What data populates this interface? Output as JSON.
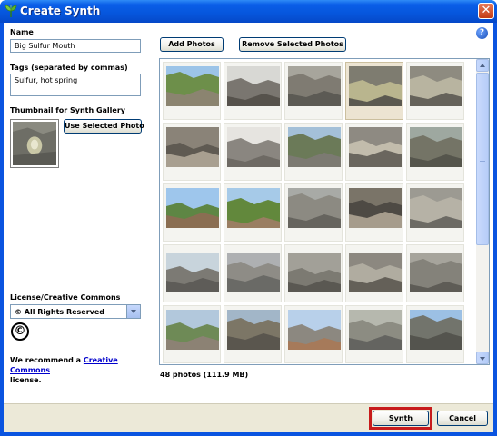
{
  "window": {
    "title": "Create Synth",
    "close_label": "✕",
    "help_label": "?"
  },
  "form": {
    "name_label": "Name",
    "name_value": "Big Sulfur Mouth",
    "tags_label": "Tags (separated by commas)",
    "tags_value": "Sulfur, hot spring",
    "thumbnail_label": "Thumbnail for Synth Gallery",
    "use_selected_photo": "Use Selected Photo",
    "license_label": "License/Creative Commons",
    "license_value": "© All Rights Reserved",
    "recommend_prefix": "We recommend a ",
    "recommend_link": "Creative Commons",
    "recommend_suffix": "license."
  },
  "toolbar": {
    "add_photos": "Add Photos",
    "remove_selected": "Remove Selected Photos"
  },
  "gallery": {
    "count_text": "48 photos (111.9 MB)",
    "selected_index": 3,
    "visible_count": 25
  },
  "footer": {
    "synth": "Synth",
    "cancel": "Cancel"
  },
  "colors": {
    "titlebar": "#0656dc",
    "footer_bg": "#ece9d8",
    "highlight": "#c71b1b",
    "link": "#0000cc"
  }
}
